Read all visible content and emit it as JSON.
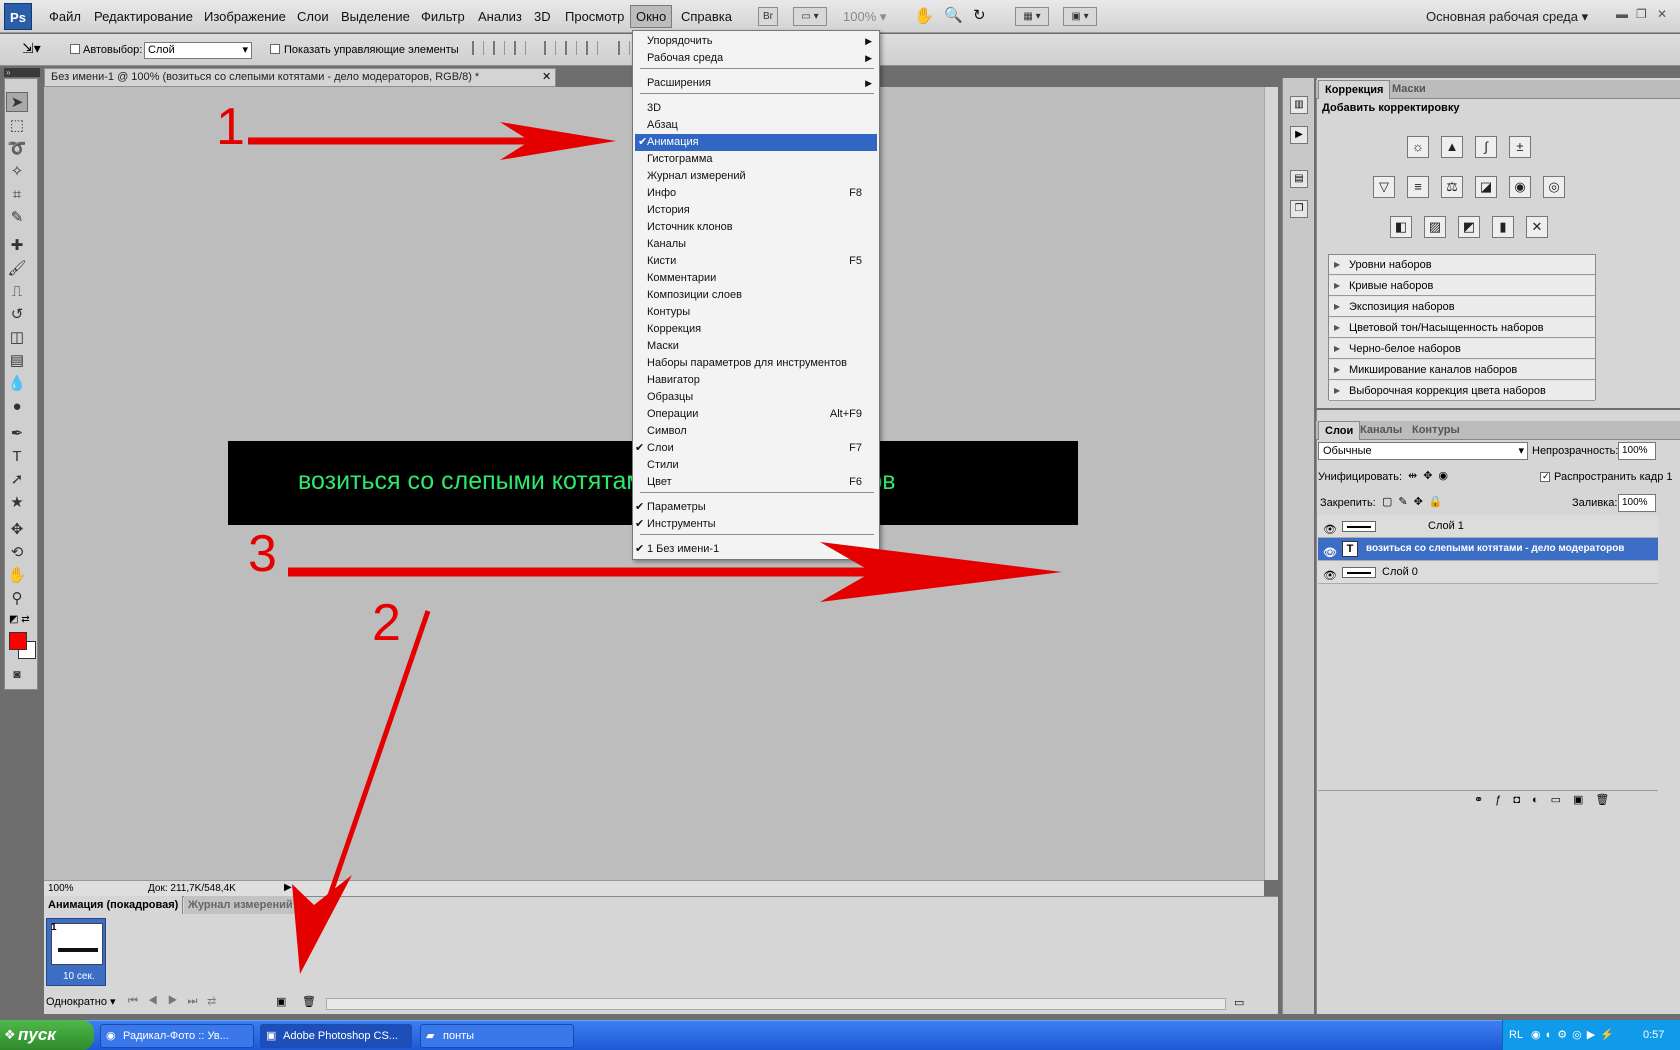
{
  "menubar": {
    "logo": "Ps",
    "items": [
      "Файл",
      "Редактирование",
      "Изображение",
      "Слои",
      "Выделение",
      "Фильтр",
      "Анализ",
      "3D",
      "Просмотр",
      "Окно",
      "Справка"
    ],
    "zoom": "100%",
    "workspace": "Основная рабочая среда",
    "bridge": "Br"
  },
  "options": {
    "autoselect_label": "Автовыбор:",
    "autoselect_value": "Слой",
    "show_controls_label": "Показать управляющие элементы"
  },
  "document": {
    "tab_title": "Без имени-1 @ 100% (возиться со слепыми котятами - дело модераторов, RGB/8) *",
    "banner_text": "возиться со слепыми котятами - дело модераторов",
    "banner_color": "#2ee86b",
    "status_zoom": "100%",
    "status_doc": "Док: 211,7K/548,4K"
  },
  "okno_menu": {
    "items": [
      {
        "label": "Упорядочить",
        "shortcut": "",
        "submenu": true,
        "checked": false
      },
      {
        "label": "Рабочая среда",
        "shortcut": "",
        "submenu": true,
        "checked": false
      },
      {
        "label": "Расширения",
        "shortcut": "",
        "submenu": true,
        "checked": false
      },
      {
        "label": "3D",
        "shortcut": "",
        "submenu": false,
        "checked": false
      },
      {
        "label": "Абзац",
        "shortcut": "",
        "submenu": false,
        "checked": false
      },
      {
        "label": "Анимация",
        "shortcut": "",
        "submenu": false,
        "checked": true,
        "highlighted": true
      },
      {
        "label": "Гистограмма",
        "shortcut": "",
        "submenu": false,
        "checked": false
      },
      {
        "label": "Журнал измерений",
        "shortcut": "",
        "submenu": false,
        "checked": false
      },
      {
        "label": "Инфо",
        "shortcut": "F8",
        "submenu": false,
        "checked": false
      },
      {
        "label": "История",
        "shortcut": "",
        "submenu": false,
        "checked": false
      },
      {
        "label": "Источник клонов",
        "shortcut": "",
        "submenu": false,
        "checked": false
      },
      {
        "label": "Каналы",
        "shortcut": "",
        "submenu": false,
        "checked": false
      },
      {
        "label": "Кисти",
        "shortcut": "F5",
        "submenu": false,
        "checked": false
      },
      {
        "label": "Комментарии",
        "shortcut": "",
        "submenu": false,
        "checked": false
      },
      {
        "label": "Композиции слоев",
        "shortcut": "",
        "submenu": false,
        "checked": false
      },
      {
        "label": "Контуры",
        "shortcut": "",
        "submenu": false,
        "checked": false
      },
      {
        "label": "Коррекция",
        "shortcut": "",
        "submenu": false,
        "checked": false
      },
      {
        "label": "Маски",
        "shortcut": "",
        "submenu": false,
        "checked": false
      },
      {
        "label": "Наборы параметров для инструментов",
        "shortcut": "",
        "submenu": false,
        "checked": false
      },
      {
        "label": "Навигатор",
        "shortcut": "",
        "submenu": false,
        "checked": false
      },
      {
        "label": "Образцы",
        "shortcut": "",
        "submenu": false,
        "checked": false
      },
      {
        "label": "Операции",
        "shortcut": "Alt+F9",
        "submenu": false,
        "checked": false
      },
      {
        "label": "Символ",
        "shortcut": "",
        "submenu": false,
        "checked": false
      },
      {
        "label": "Слои",
        "shortcut": "F7",
        "submenu": false,
        "checked": true
      },
      {
        "label": "Стили",
        "shortcut": "",
        "submenu": false,
        "checked": false
      },
      {
        "label": "Цвет",
        "shortcut": "F6",
        "submenu": false,
        "checked": false
      },
      {
        "label": "Параметры",
        "shortcut": "",
        "submenu": false,
        "checked": true
      },
      {
        "label": "Инструменты",
        "shortcut": "",
        "submenu": false,
        "checked": true
      },
      {
        "label": "1 Без имени-1",
        "shortcut": "",
        "submenu": false,
        "checked": true
      }
    ]
  },
  "annotations": {
    "n1": "1",
    "n2": "2",
    "n3": "3",
    "arrow_color": "#e50000"
  },
  "animation_panel": {
    "tabs": [
      "Анимация (покадровая)",
      "Журнал измерений"
    ],
    "frame_number": "1",
    "frame_delay": "10 сек.",
    "loop": "Однократно"
  },
  "correction_panel": {
    "tabs": [
      "Коррекция",
      "Маски"
    ],
    "title": "Добавить корректировку",
    "presets": [
      "Уровни наборов",
      "Кривые наборов",
      "Экспозиция наборов",
      "Цветовой тон/Насыщенность наборов",
      "Черно-белое наборов",
      "Микширование каналов наборов",
      "Выборочная коррекция цвета наборов"
    ]
  },
  "layers_panel": {
    "tabs": [
      "Слои",
      "Каналы",
      "Контуры"
    ],
    "blend_mode": "Обычные",
    "opacity_label": "Непрозрачность:",
    "opacity": "100%",
    "unify_label": "Унифицировать:",
    "propagate_label": "Распространить кадр 1",
    "lock_label": "Закрепить:",
    "fill_label": "Заливка:",
    "fill": "100%",
    "layers": [
      {
        "name": "Слой 1",
        "selected": false
      },
      {
        "name": "возиться со слепыми котятами - дело модераторов",
        "selected": true
      },
      {
        "name": "Слой 0",
        "selected": false
      }
    ]
  },
  "taskbar": {
    "start": "пуск",
    "tasks": [
      "Радикал-Фото :: Ув...",
      "Adobe Photoshop CS...",
      "понты"
    ],
    "lang": "RL",
    "time": "0:57"
  }
}
